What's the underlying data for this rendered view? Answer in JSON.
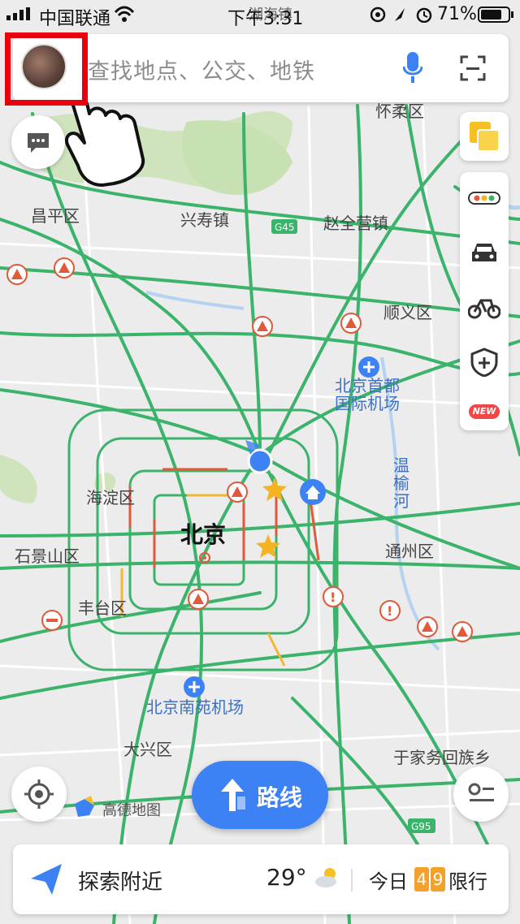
{
  "status_bar": {
    "carrier": "中国联通",
    "time": "下午3:31",
    "battery": "71%"
  },
  "search": {
    "placeholder": "查找地点、公交、地铁"
  },
  "map": {
    "labels": {
      "huairou": "怀柔区",
      "changping": "昌平区",
      "xingshou": "兴寿镇",
      "zhaoquanying": "赵全营镇",
      "shunyi": "顺义区",
      "airport1": "北京首都",
      "airport2": "国际机场",
      "wenyu1": "温",
      "wenyu2": "榆",
      "wenyu3": "河",
      "haidian": "海淀区",
      "beijing": "北京",
      "shijingshan": "石景山区",
      "tongzhou": "通州区",
      "fengtai": "丰台区",
      "nanyuan": "北京南苑机场",
      "daxing": "大兴区",
      "yujiawu": "于家务回族乡",
      "top_partial": "湖海镇",
      "g45": "G45",
      "g95": "G95"
    },
    "logo": "高德地图"
  },
  "controls": {
    "new_badge": "NEW"
  },
  "route_button": {
    "label": "路线"
  },
  "bottom_bar": {
    "explore": "探索附近",
    "temperature": "29°",
    "today": "今日",
    "limit_digit_1": "4",
    "limit_digit_2": "9",
    "limit_suffix": "限行"
  },
  "colors": {
    "accent": "#3d82f5",
    "road": "#3bb36b",
    "annotation": "#e8000c",
    "plate": "#f3a12a"
  }
}
